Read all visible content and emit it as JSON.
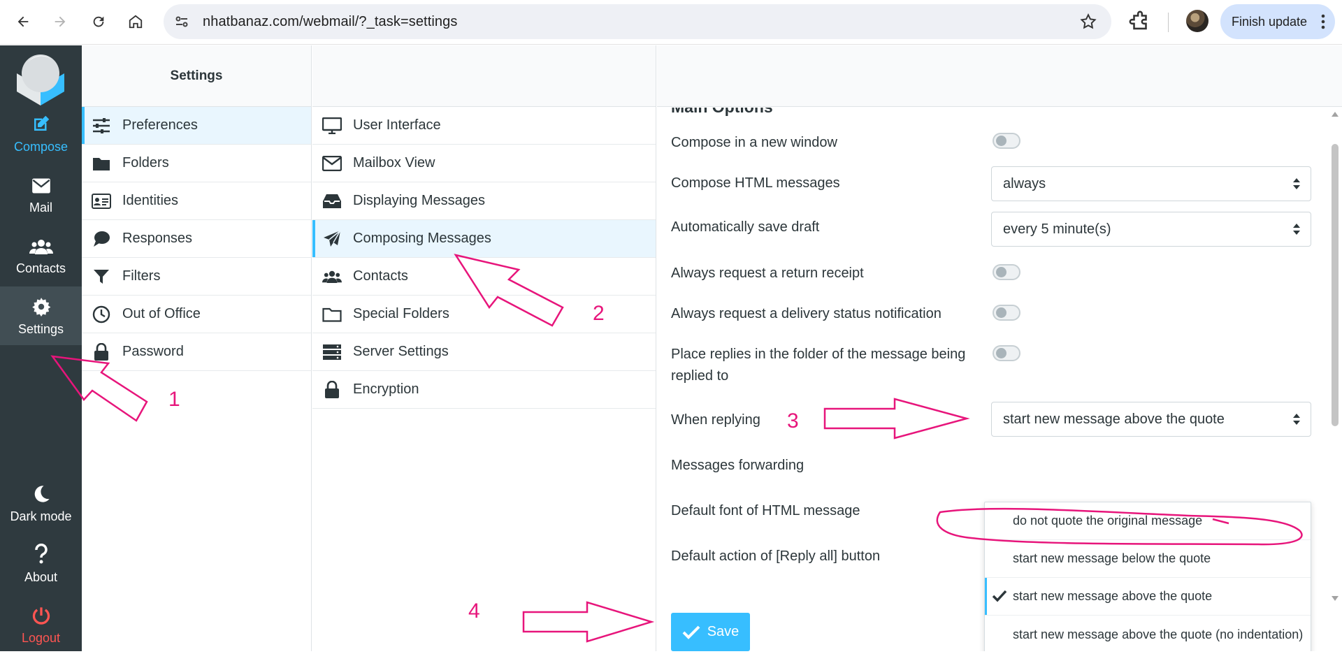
{
  "browser": {
    "url": "nhatbanaz.com/webmail/?_task=settings",
    "finish_update": "Finish update",
    "icons": [
      "back-icon",
      "forward-icon",
      "reload-icon",
      "home-icon",
      "site-info-icon",
      "star-icon",
      "extensions-icon",
      "profile-avatar",
      "menu-dots-icon"
    ]
  },
  "nav": {
    "items": [
      {
        "label": "Compose",
        "icon": "compose-icon"
      },
      {
        "label": "Mail",
        "icon": "mail-icon"
      },
      {
        "label": "Contacts",
        "icon": "contacts-icon"
      },
      {
        "label": "Settings",
        "icon": "gear-icon"
      }
    ],
    "bottom": [
      {
        "label": "Dark mode",
        "icon": "moon-icon"
      },
      {
        "label": "About",
        "icon": "question-icon"
      },
      {
        "label": "Logout",
        "icon": "power-icon"
      }
    ]
  },
  "settings": {
    "title": "Settings",
    "items": [
      "Preferences",
      "Folders",
      "Identities",
      "Responses",
      "Filters",
      "Out of Office",
      "Password"
    ]
  },
  "sections": {
    "items": [
      "User Interface",
      "Mailbox View",
      "Displaying Messages",
      "Composing Messages",
      "Contacts",
      "Special Folders",
      "Server Settings",
      "Encryption"
    ]
  },
  "form": {
    "section_title": "Main Options",
    "rows": {
      "new_window": "Compose in a new window",
      "html": "Compose HTML messages",
      "draft": "Automatically save draft",
      "receipt": "Always request a return receipt",
      "dsn": "Always request a delivery status notification",
      "replies_folder": "Place replies in the folder of the message being replied to",
      "when_replying": "When replying",
      "forwarding": "Messages forwarding",
      "font": "Default font of HTML message",
      "reply_all": "Default action of [Reply all] button"
    },
    "html_value": "always",
    "draft_value": "every 5 minute(s)",
    "reply_value": "start new message above the quote",
    "reply_options": [
      "do not quote the original message",
      "start new message below the quote",
      "start new message above the quote",
      "start new message above the quote (no indentation)"
    ],
    "save_label": "Save"
  },
  "annotations": [
    "1",
    "2",
    "3",
    "4"
  ],
  "colors": {
    "accent": "#37beff",
    "nav_bg": "#2f3a3f",
    "annotation": "#e7157b",
    "logout": "#ff5552"
  }
}
